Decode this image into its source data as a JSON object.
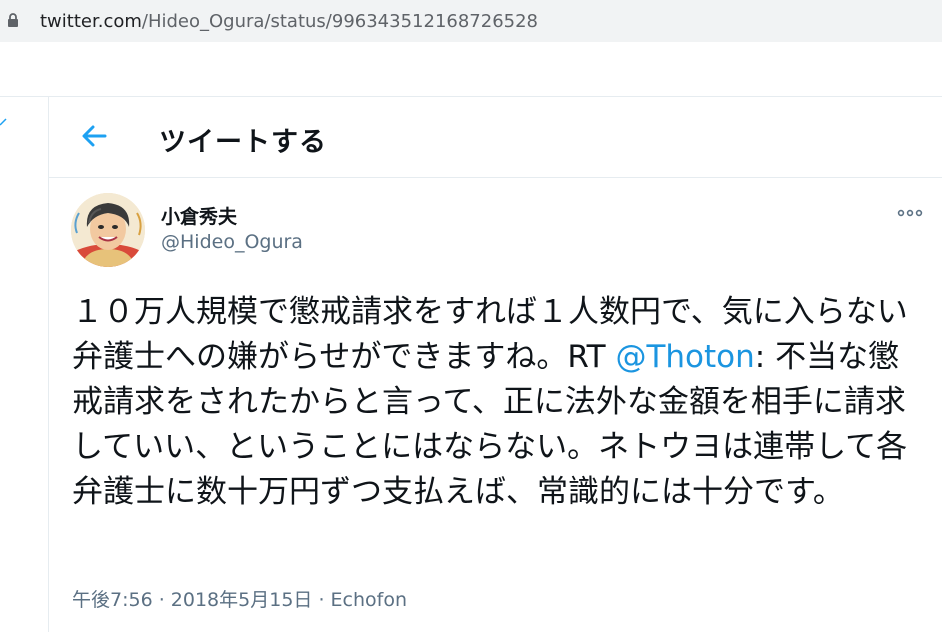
{
  "browser": {
    "url_host": "twitter.com",
    "url_path": "/Hideo_Ogura/status/996343512168726528"
  },
  "header": {
    "title": "ツイートする"
  },
  "tweet": {
    "author_name": "小倉秀夫",
    "author_handle": "@Hideo_Ogura",
    "text_part1": "１０万人規模で懲戒請求をすれば１人数円で、気に入らない弁護士への嫌がらせができますね。RT ",
    "mention": "@Thoton",
    "text_part2": ": 不当な懲戒請求をされたからと言って、正に法外な金額を相手に請求していい、ということにはならない。ネトウヨは連帯して各弁護士に数十万円ずつ支払えば、常識的には十分です。",
    "time": "午後7:56",
    "separator1": " · ",
    "date": "2018年5月15日",
    "separator2": " · ",
    "source": "Echofon"
  },
  "colors": {
    "accent": "#1da1f2",
    "mention": "#1b95e0",
    "secondary_text": "#5b7083",
    "divider": "#e6ecf0"
  },
  "icons": {
    "lock": "lock-icon",
    "back": "back-arrow-icon",
    "more": "more-icon"
  }
}
